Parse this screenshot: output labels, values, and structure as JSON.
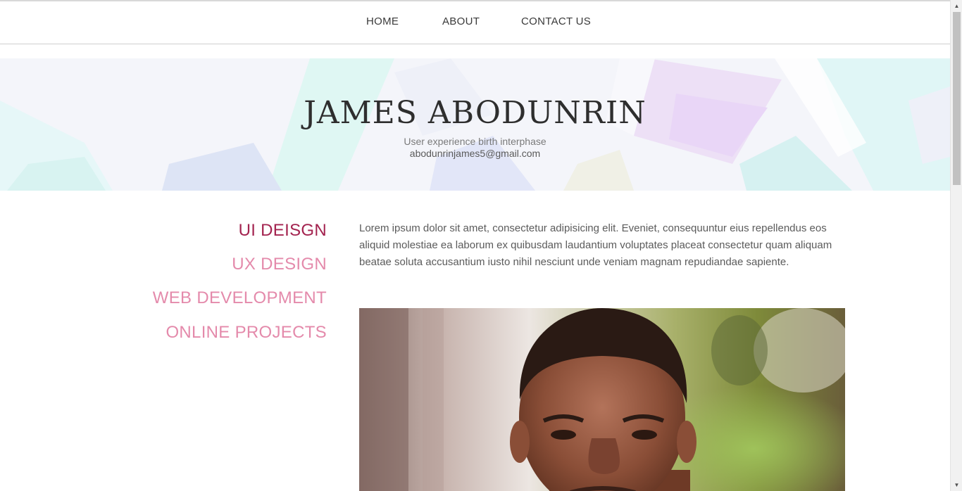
{
  "nav": {
    "home": "HOME",
    "about": "ABOUT",
    "contact": "CONTACT US"
  },
  "hero": {
    "name": "JAMES ABODUNRIN",
    "tagline": "User experience birth interphase",
    "email": "abodunrinjames5@gmail.com"
  },
  "side_menu": {
    "items": [
      {
        "label": "UI DEISGN",
        "active": true
      },
      {
        "label": "UX DESIGN",
        "active": false
      },
      {
        "label": "WEB DEVELOPMENT",
        "active": false
      },
      {
        "label": "ONLINE PROJECTS",
        "active": false
      }
    ]
  },
  "main": {
    "intro": "Lorem ipsum dolor sit amet, consectetur adipisicing elit. Eveniet, consequuntur eius repellendus eos aliquid molestiae ea laborum ex quibusdam laudantium voluptates placeat consectetur quam aliquam beatae soluta accusantium iusto nihil nesciunt unde veniam magnam repudiandae sapiente."
  },
  "colors": {
    "accent_active": "#a3234f",
    "accent": "#e48aab",
    "text": "#5b5b5b"
  },
  "icons": {
    "scroll_up": "triangle-up-icon",
    "scroll_down": "triangle-down-icon"
  }
}
